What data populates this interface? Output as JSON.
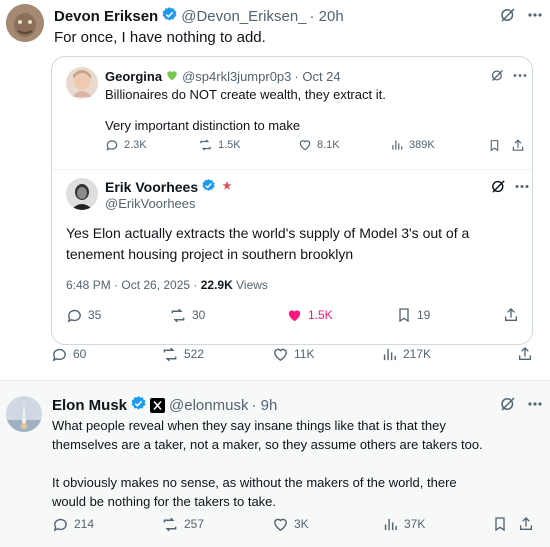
{
  "post1": {
    "author_name": "Devon Eriksen",
    "handle": "@Devon_Eriksen_",
    "time": "· 20h",
    "text": "For once, I have nothing to add.",
    "actions": {
      "replies": "60",
      "reposts": "522",
      "likes": "11K",
      "views": "217K"
    }
  },
  "quote": {
    "author_name": "Georgina",
    "handle": "@sp4rkl3jumpr0p3",
    "time": "· Oct 24",
    "line1": "Billionaires do NOT create wealth, they extract it.",
    "line2": "Very important distinction to make",
    "actions": {
      "replies": "2.3K",
      "reposts": "1.5K",
      "likes": "8.1K",
      "views": "389K"
    }
  },
  "nested": {
    "author_name": "Erik Voorhees",
    "handle": "@ErikVoorhees",
    "text_line1": "Yes Elon actually extracts the world's supply of Model 3's out of a",
    "text_line2": "tenement housing project in southern brooklyn",
    "timestamp": "6:48 PM · Oct 26, 2025 ·",
    "views_count": "22.9K",
    "views_label": "Views",
    "actions": {
      "replies": "35",
      "reposts": "30",
      "likes": "1.5K",
      "bookmarks": "19"
    }
  },
  "post2": {
    "author_name": "Elon Musk",
    "handle": "@elonmusk",
    "time": "· 9h",
    "para1_line1": "What people reveal when they say insane things like that is that they",
    "para1_line2": "themselves are a taker, not a maker, so they assume others are takers too.",
    "para2_line1": "It obviously makes no sense, as without the makers of the world, there",
    "para2_line2": "would be nothing for the takers to take.",
    "actions": {
      "replies": "214",
      "reposts": "257",
      "likes": "3K",
      "views": "37K"
    }
  },
  "colors": {
    "verified_blue": "#1d9bf0",
    "like_pink": "#f91880",
    "muted": "#536471",
    "border": "#cfd9de",
    "green_heart": "#7ac74f"
  }
}
